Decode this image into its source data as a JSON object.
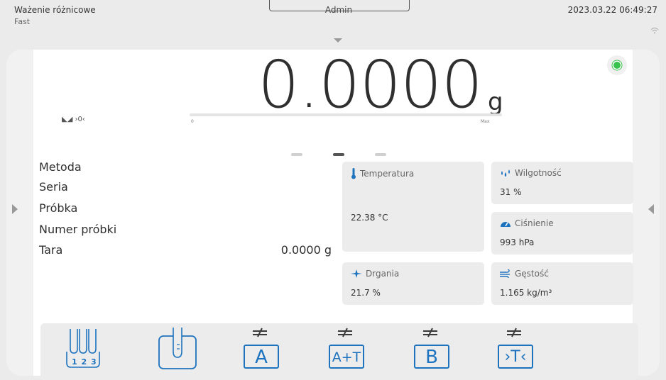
{
  "header": {
    "mode_title": "Ważenie różnicowe",
    "profile": "Fast",
    "user": "Admin",
    "datetime": "2023.03.22 06:49:27"
  },
  "weighing": {
    "value": "0.0000",
    "unit": "g",
    "zero_indicator": "◣◢ ›0‹",
    "bar_min": "0",
    "bar_max": "Max",
    "bar_fill_fraction": 0
  },
  "info": {
    "rows": [
      {
        "label": "Metoda",
        "value": ""
      },
      {
        "label": "Seria",
        "value": ""
      },
      {
        "label": "Próbka",
        "value": ""
      },
      {
        "label": "Numer próbki",
        "value": ""
      },
      {
        "label": "Tara",
        "value": "0.0000 g"
      }
    ]
  },
  "tiles": {
    "temperature": {
      "label": "Temperatura",
      "value": "22.38 °C",
      "icon": "thermometer-icon"
    },
    "humidity": {
      "label": "Wilgotność",
      "value": "31 %",
      "icon": "droplets-icon"
    },
    "pressure": {
      "label": "Ciśnienie",
      "value": "993 hPa",
      "icon": "gauge-icon"
    },
    "vibration": {
      "label": "Drgania",
      "value": "21.7 %",
      "icon": "vibration-icon"
    },
    "density": {
      "label": "Gęstość",
      "value": "1.165 kg/m³",
      "icon": "air-density-icon"
    }
  },
  "toolbar": {
    "series_digits": "1 2 3",
    "tare_a": "A",
    "tare_at": "A+T",
    "tare_b": "B",
    "tare_t": "›T‹"
  },
  "colors": {
    "accent": "#1e73be",
    "stable": "#39c24d",
    "background": "#ebebeb",
    "card": "#ffffff",
    "tile": "#ececec"
  }
}
